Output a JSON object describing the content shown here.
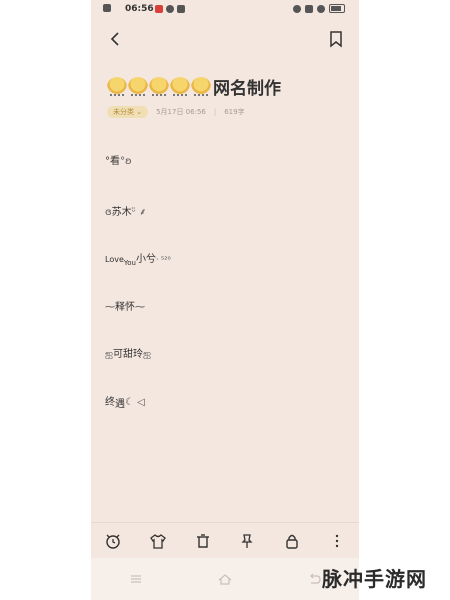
{
  "status_bar": {
    "time": "06:56"
  },
  "note": {
    "title": "网名制作",
    "category": "未分类",
    "date": "5月17日 06:56",
    "separator": "|",
    "word_count": "619字"
  },
  "entries": [
    {
      "text": "°看",
      "suffix": "°ʚ"
    },
    {
      "prefix": "ɞ",
      "text": "苏木",
      "suffix": "ᵕ̈ ⸙"
    },
    {
      "text": "Love",
      "sub": "You",
      "text2": "小兮",
      "suffix": "· ⁵²⁰"
    },
    {
      "prefix": "⁓",
      "text": "释怀",
      "suffix": "⁓"
    },
    {
      "prefix": "ஐ",
      "text": "可甜玲",
      "suffix": "ஐ"
    },
    {
      "text": "终",
      "text2": "遇",
      "suffix": "☾ ◁"
    }
  ],
  "watermark": "脉冲手游网"
}
